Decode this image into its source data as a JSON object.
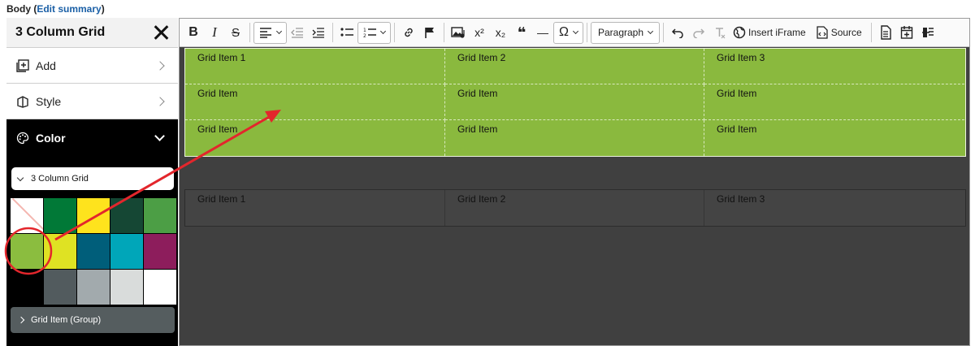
{
  "field": {
    "label": "Body",
    "link": "Edit summary"
  },
  "sidebar": {
    "title": "3 Column Grid",
    "rows": [
      {
        "label": "Add",
        "icon": "add-box-icon"
      },
      {
        "label": "Style",
        "icon": "style-icon"
      }
    ],
    "color_section": {
      "label": "Color",
      "icon": "palette-icon"
    },
    "select": {
      "value": "3 Column Grid"
    },
    "swatches": [
      "none",
      "#017937",
      "#fee31d",
      "#154734",
      "#4c9e45",
      "#8bbd3f",
      "#dfe223",
      "#005e7a",
      "#00a6b9",
      "#8d1d5c",
      "blank",
      "#525b5e",
      "#a2aaad",
      "#d9dcdb",
      "#ffffff"
    ],
    "selected_swatch": "#8bbd3f",
    "group_button": "Grid Item (Group)"
  },
  "toolbar": {
    "bold": "B",
    "italic": "I",
    "strike": "S",
    "superscript": "x²",
    "subscript": "x₂",
    "blockquote": "❝",
    "hr": "—",
    "special_chars": "Ω",
    "heading_dropdown": "Paragraph",
    "insert_iframe": "Insert iFrame",
    "source": "Source"
  },
  "grid_green": [
    [
      "Grid Item 1",
      "Grid Item 2",
      "Grid Item 3"
    ],
    [
      "Grid Item",
      "Grid Item",
      "Grid Item"
    ],
    [
      "Grid Item",
      "Grid Item",
      "Grid Item"
    ]
  ],
  "grid_dark": [
    "Grid Item 1",
    "Grid Item 2",
    "Grid Item 3"
  ],
  "colors": {
    "accent_annotation": "#e3262c",
    "applied_green": "#8ab93e"
  }
}
